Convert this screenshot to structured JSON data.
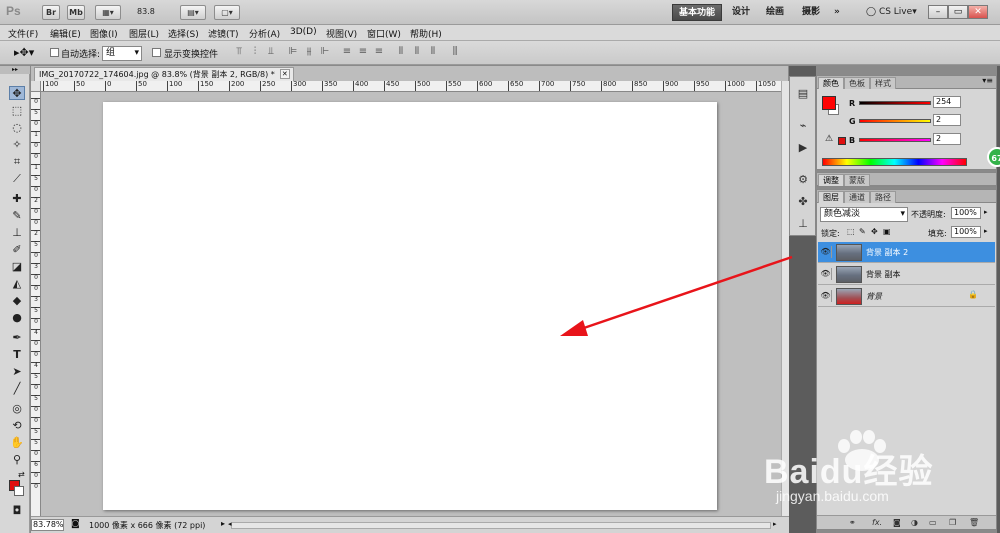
{
  "appbar": {
    "logo": "Ps",
    "bridge": "Br",
    "minibridge": "Mb",
    "zoom": "83.8",
    "workspaces": [
      "基本功能",
      "设计",
      "绘画",
      "摄影"
    ],
    "more": "»",
    "cslive": "CS Live",
    "min": "–",
    "restore": "▭",
    "close": "✕"
  },
  "menu": [
    "文件(F)",
    "编辑(E)",
    "图像(I)",
    "图层(L)",
    "选择(S)",
    "滤镜(T)",
    "分析(A)",
    "3D(D)",
    "视图(V)",
    "窗口(W)",
    "帮助(H)"
  ],
  "options": {
    "auto_select_label": "自动选择:",
    "auto_select_value": "组",
    "show_transform_label": "显示变换控件"
  },
  "document": {
    "tab_title": "IMG_20170722_174604.jpg @ 83.8% (背景 副本 2, RGB/8) *",
    "ruler_h": [
      "100",
      "50",
      "0",
      "50",
      "100",
      "150",
      "200",
      "250",
      "300",
      "350",
      "400",
      "450",
      "500",
      "550",
      "600",
      "650",
      "700",
      "750",
      "800",
      "850",
      "900",
      "950",
      "1000",
      "1050"
    ],
    "ruler_v": [
      "0",
      "5",
      "0",
      "1",
      "0",
      "0",
      "1",
      "5",
      "0",
      "2",
      "0",
      "0",
      "2",
      "5",
      "0",
      "3",
      "0",
      "0",
      "3",
      "5",
      "0",
      "4",
      "0",
      "0",
      "4",
      "5",
      "0",
      "5",
      "0",
      "0",
      "5",
      "5",
      "0",
      "6",
      "0",
      "0"
    ]
  },
  "status": {
    "zoom": "83.78%",
    "docinfo": "1000 像素 x 666 像素 (72 ppi)"
  },
  "color_panel": {
    "tabs": [
      "颜色",
      "色板",
      "样式"
    ],
    "r_label": "R",
    "r_value": "254",
    "g_label": "G",
    "g_value": "2",
    "b_label": "B",
    "b_value": "2",
    "fg_color": "#fe0202"
  },
  "adjust_panel": {
    "tabs": [
      "调整",
      "蒙版"
    ]
  },
  "layers_panel": {
    "tabs": [
      "图层",
      "通道",
      "路径"
    ],
    "blend_mode": "颜色减淡",
    "opacity_label": "不透明度:",
    "opacity_value": "100%",
    "lock_label": "锁定:",
    "fill_label": "填充:",
    "fill_value": "100%",
    "layers": [
      {
        "name": "背景 副本 2"
      },
      {
        "name": "背景 副本"
      },
      {
        "name": "背景"
      }
    ]
  },
  "watermark": {
    "main": "Baidu经验",
    "sub": "jingyan.baidu.com"
  },
  "badge": "67"
}
